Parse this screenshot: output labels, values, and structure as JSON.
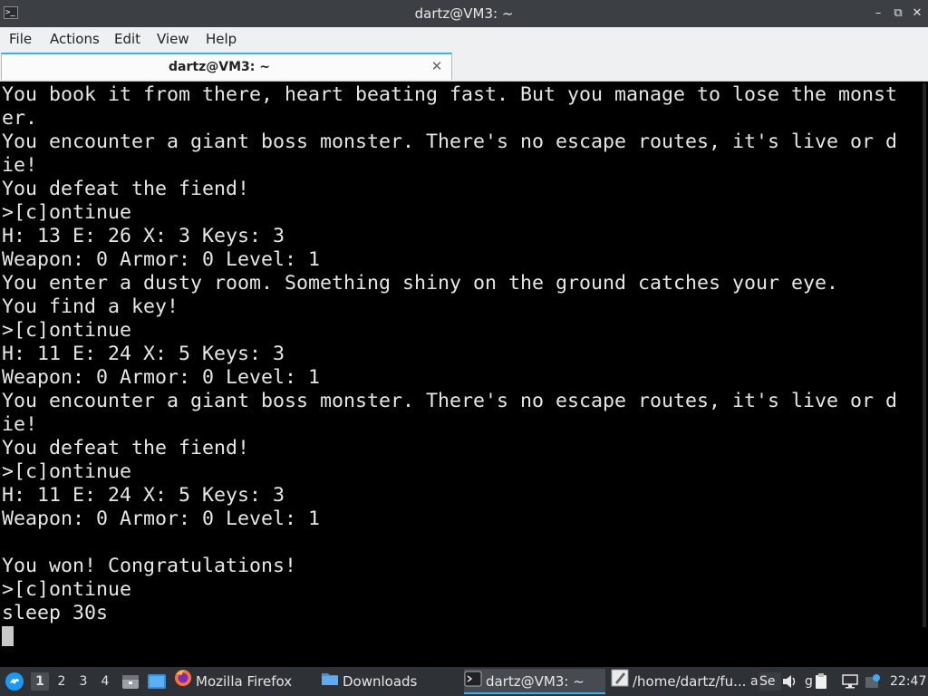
{
  "window": {
    "title": "dartz@VM3: ~",
    "app_icon_glyph": ">_",
    "buttons": {
      "minimize": "–",
      "maximize": "⧉",
      "close": "✕"
    }
  },
  "menubar": {
    "items": [
      "File",
      "Actions",
      "Edit",
      "View",
      "Help"
    ]
  },
  "tabs": [
    {
      "label": "dartz@VM3: ~",
      "close": "✕"
    }
  ],
  "terminal": {
    "lines": [
      "You book it from there, heart beating fast. But you manage to lose the monst",
      "er.",
      "You encounter a giant boss monster. There's no escape routes, it's live or d",
      "ie!",
      "You defeat the fiend!",
      ">[c]ontinue",
      "H: 13 E: 26 X: 3 Keys: 3",
      "Weapon: 0 Armor: 0 Level: 1",
      "You enter a dusty room. Something shiny on the ground catches your eye.",
      "You find a key!",
      ">[c]ontinue",
      "H: 11 E: 24 X: 5 Keys: 3",
      "Weapon: 0 Armor: 0 Level: 1",
      "You encounter a giant boss monster. There's no escape routes, it's live or d",
      "ie!",
      "You defeat the fiend!",
      ">[c]ontinue",
      "H: 11 E: 24 X: 5 Keys: 3",
      "Weapon: 0 Armor: 0 Level: 1",
      "",
      "You won! Congratulations!",
      ">[c]ontinue",
      "sleep 30s"
    ]
  },
  "taskbar": {
    "workspaces": [
      "1",
      "2",
      "3",
      "4"
    ],
    "active_workspace": "1",
    "tasks": [
      {
        "label": "Mozilla Firefox",
        "icon": "firefox-icon"
      },
      {
        "label": "Downloads",
        "icon": "folder-icon"
      },
      {
        "label": "dartz@VM3: ~",
        "icon": "terminal-icon",
        "active": true
      },
      {
        "label": "/home/dartz/fu...",
        "icon": "text-editor-icon"
      }
    ],
    "tray_text": [
      "a",
      "Se",
      "g"
    ],
    "clock": "22:47"
  },
  "colors": {
    "titlebar_bg": "#3c3f44",
    "menubar_bg": "#eff0f1",
    "terminal_bg": "#000000",
    "terminal_fg": "#e6e6e6",
    "taskbar_bg": "#2e3136",
    "accent": "#3daee9"
  }
}
